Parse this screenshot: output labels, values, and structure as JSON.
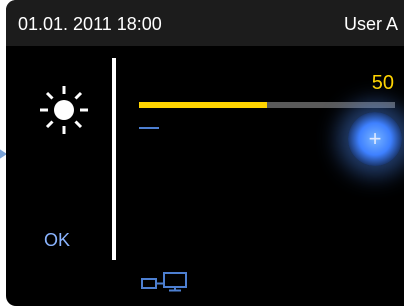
{
  "header": {
    "datetime": "01.01. 2011 18:00",
    "user": "User A"
  },
  "brightness": {
    "icon": "sun-icon",
    "value": "50",
    "level_percent": 50,
    "minus_icon": "minus-icon",
    "plus_icon": "plus-icon",
    "plus_symbol": "+",
    "ok_label": "OK",
    "accent_color": "#ffd400",
    "control_color": "#3e80ff"
  },
  "footer": {
    "network_icon": "network-icon"
  }
}
